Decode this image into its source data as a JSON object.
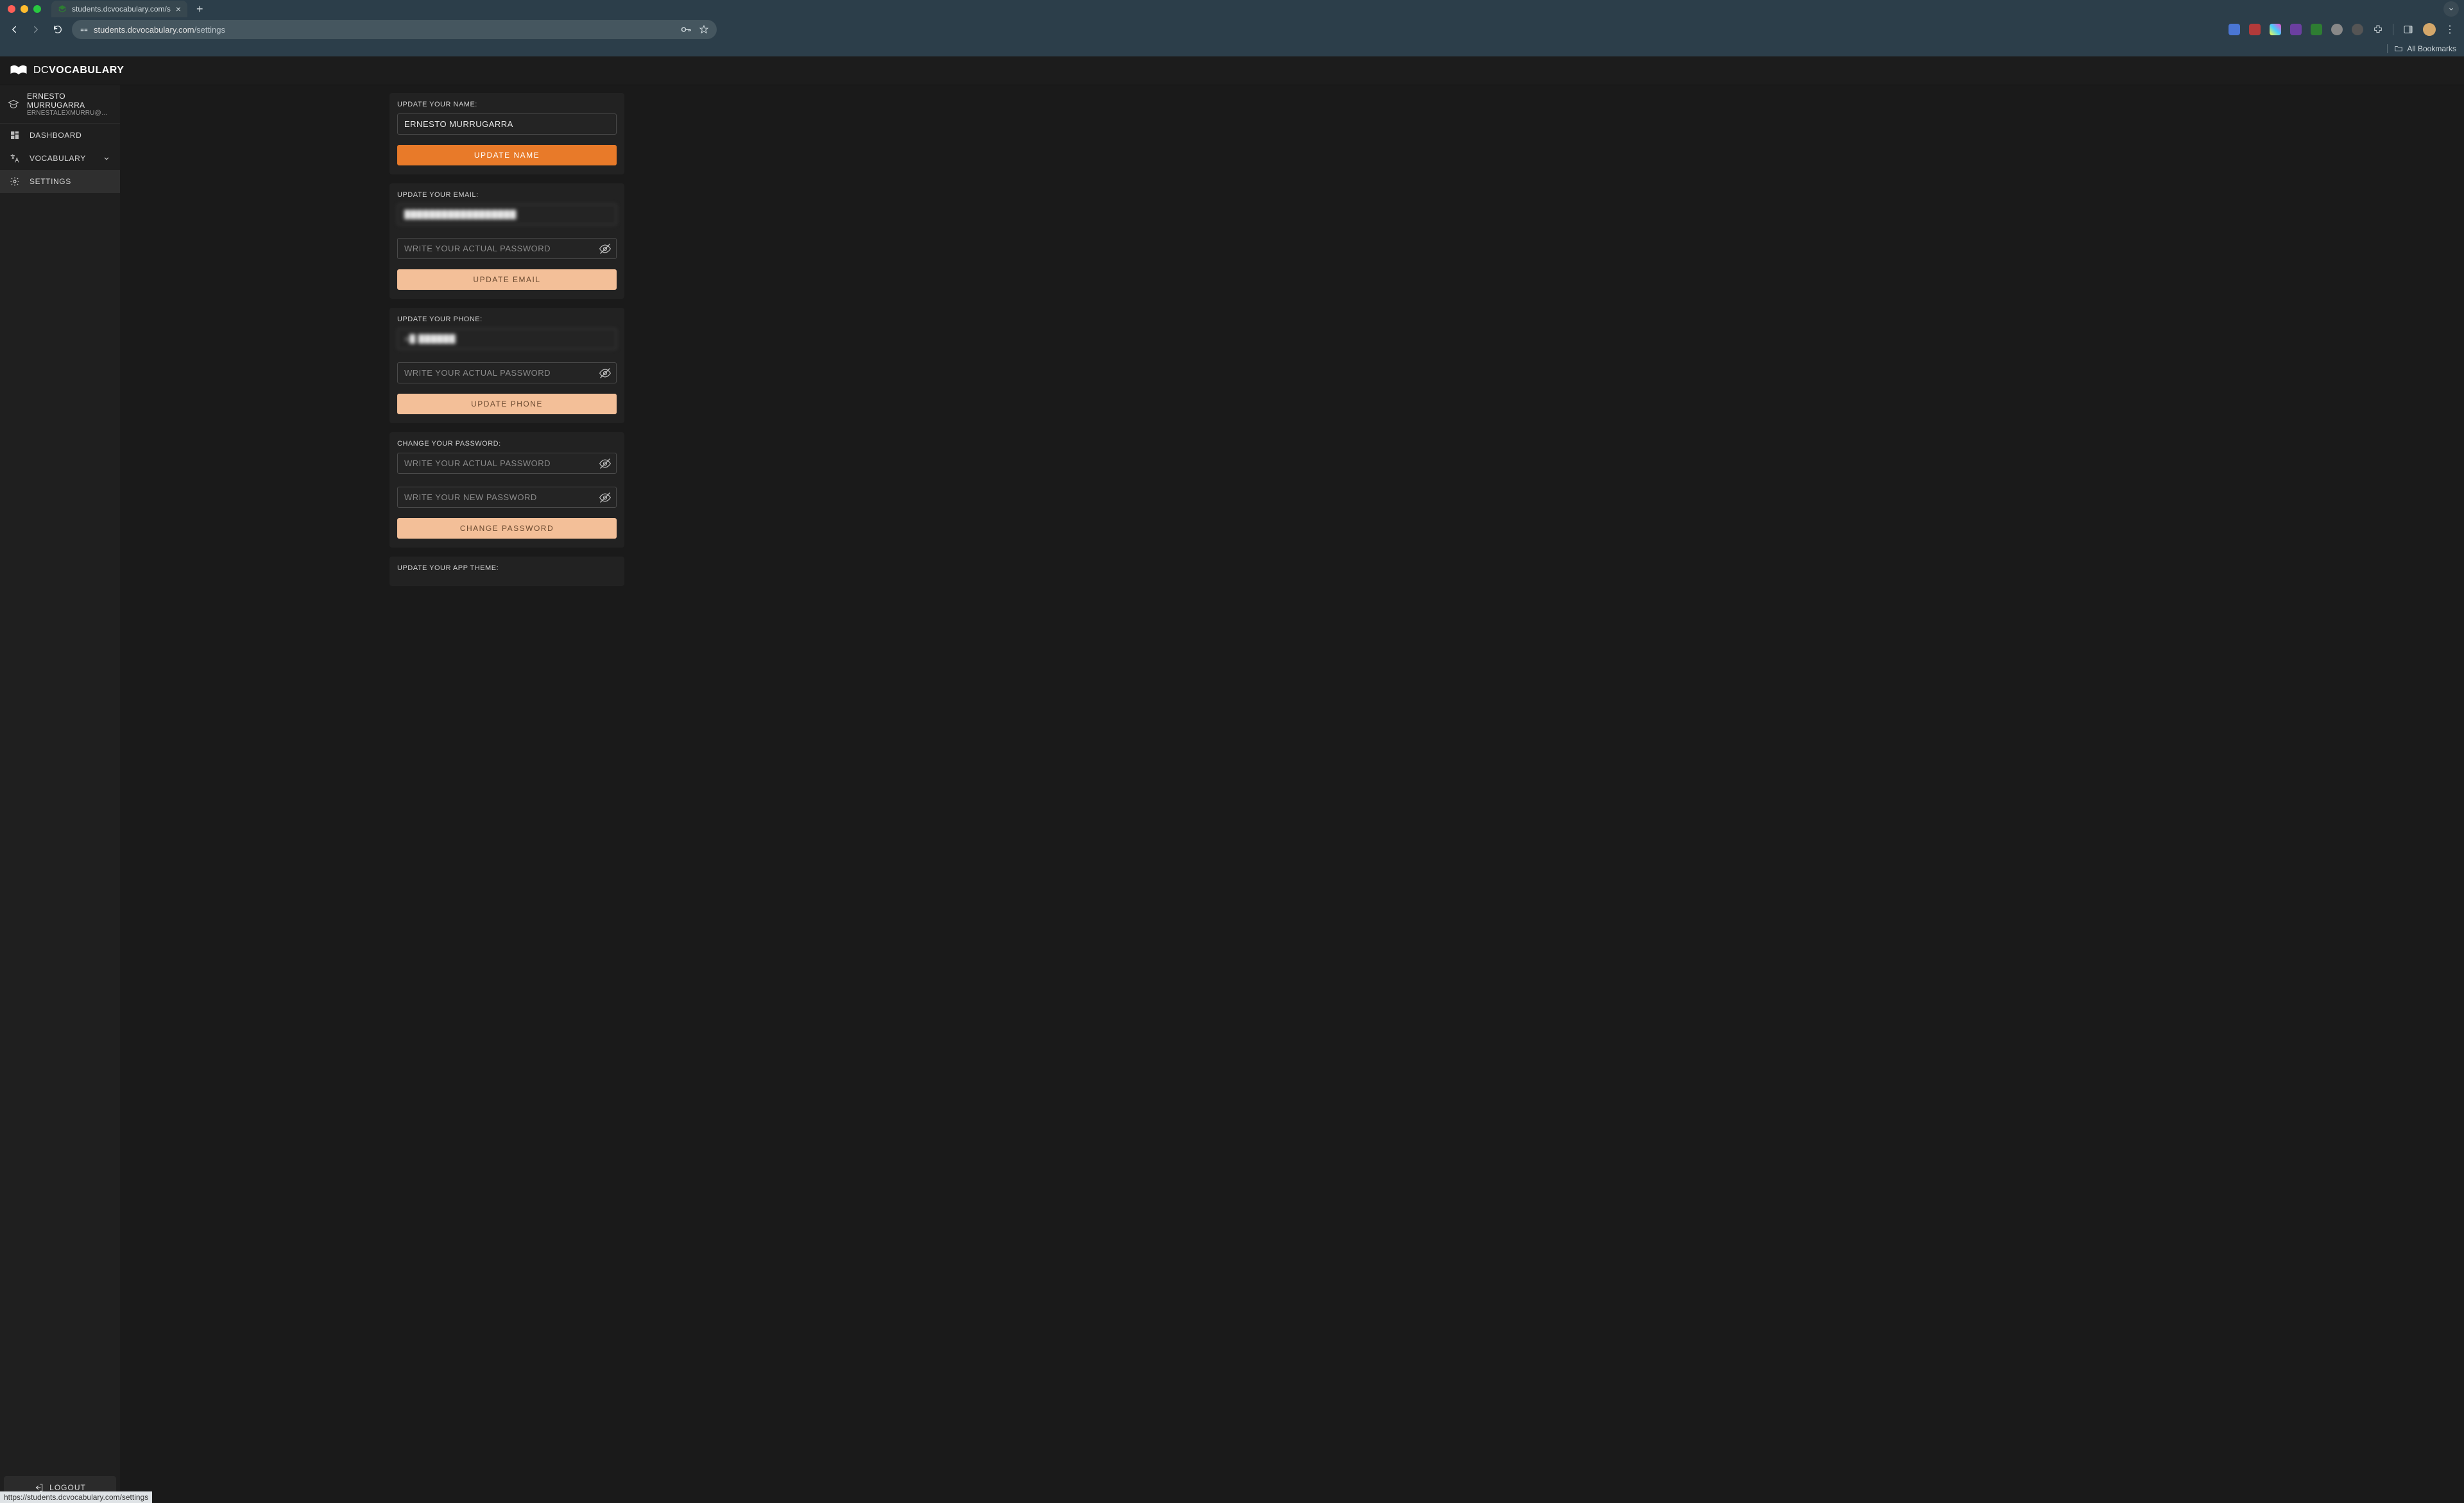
{
  "browser": {
    "tab_title": "students.dcvocabulary.com/s",
    "url_host": "students.dcvocabulary.com",
    "url_path": "/settings",
    "bookmarks_label": "All Bookmarks",
    "status_url": "https://students.dcvocabulary.com/settings"
  },
  "brand": {
    "name_thin": "DC",
    "name_bold": "VOCABULARY"
  },
  "user": {
    "name": "ERNESTO MURRUGARRA",
    "email": "ERNESTALEXMURRU@GMAIL.COM"
  },
  "sidebar": {
    "items": [
      {
        "label": "DASHBOARD",
        "icon": "dashboard"
      },
      {
        "label": "VOCABULARY",
        "icon": "translate",
        "expandable": true
      },
      {
        "label": "SETTINGS",
        "icon": "gear",
        "active": true
      }
    ],
    "logout_label": "LOGOUT"
  },
  "settings": {
    "name_card": {
      "title": "UPDATE YOUR NAME:",
      "value": "ERNESTO MURRUGARRA",
      "button": "UPDATE NAME"
    },
    "email_card": {
      "title": "UPDATE YOUR EMAIL:",
      "value_masked": "██████████████████",
      "password_placeholder": "WRITE YOUR ACTUAL PASSWORD",
      "button": "UPDATE EMAIL"
    },
    "phone_card": {
      "title": "UPDATE YOUR PHONE:",
      "value_masked": "+█ ██████",
      "password_placeholder": "WRITE YOUR ACTUAL PASSWORD",
      "button": "UPDATE PHONE"
    },
    "password_card": {
      "title": "CHANGE YOUR PASSWORD:",
      "current_placeholder": "WRITE YOUR ACTUAL PASSWORD",
      "new_placeholder": "WRITE YOUR NEW PASSWORD",
      "button": "CHANGE PASSWORD"
    },
    "theme_card": {
      "title": "UPDATE YOUR APP THEME:"
    }
  }
}
